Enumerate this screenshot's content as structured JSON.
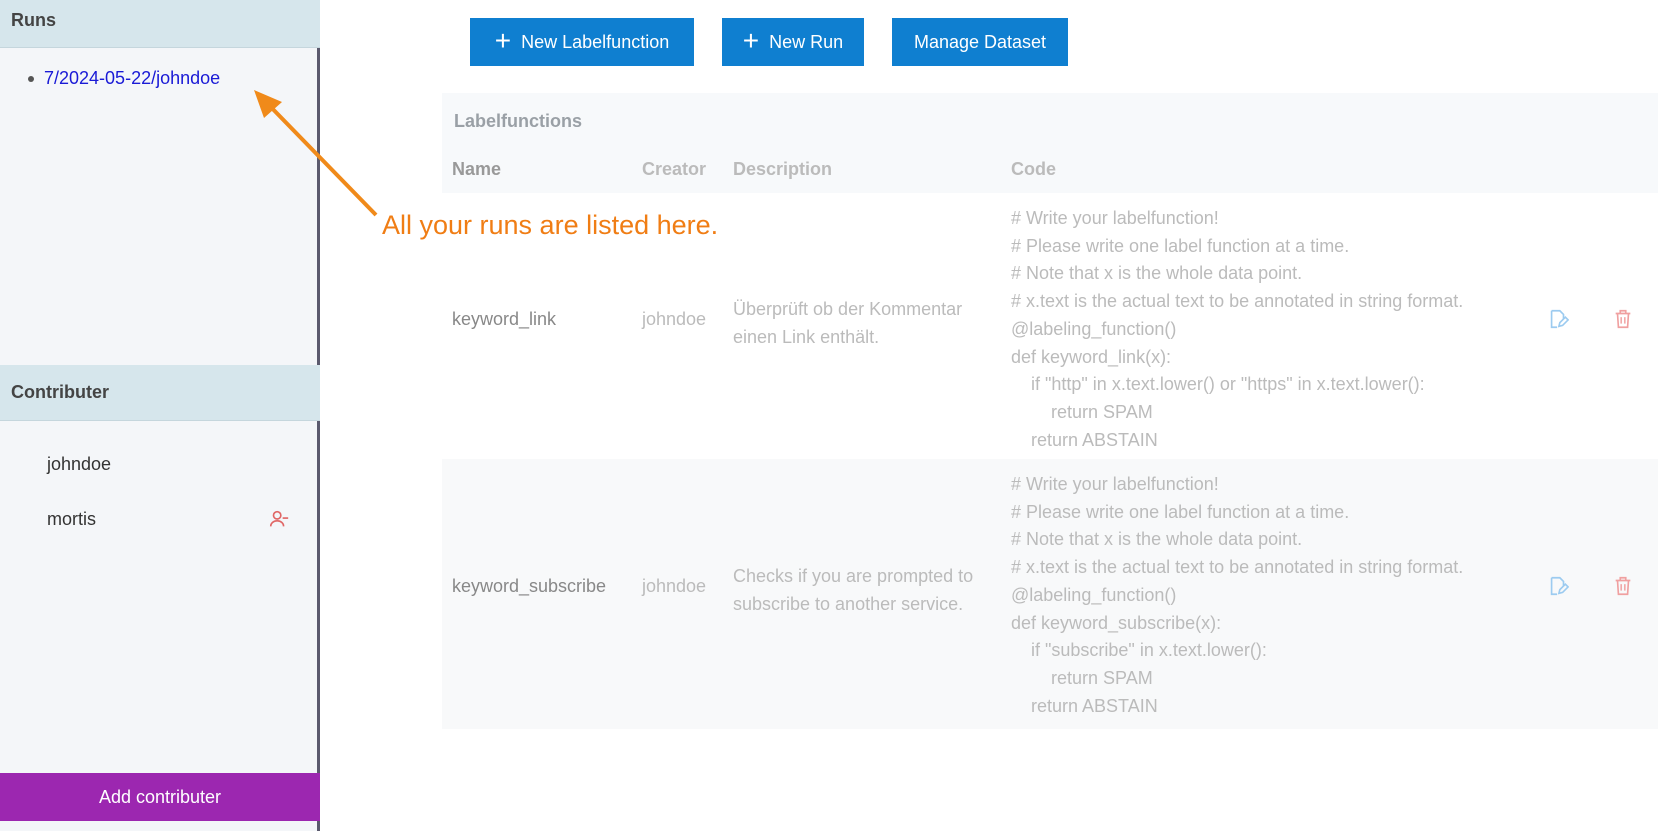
{
  "sidebar": {
    "runs_title": "Runs",
    "runs": [
      "7/2024-05-22/johndoe"
    ],
    "contributers_title": "Contributer",
    "contributers": [
      "johndoe",
      "mortis"
    ],
    "add_contributer_label": "Add contributer"
  },
  "toolbar": {
    "new_labelfunction_label": "New Labelfunction",
    "new_run_label": "New Run",
    "manage_dataset_label": "Manage Dataset"
  },
  "table": {
    "title": "Labelfunctions",
    "columns": {
      "name": "Name",
      "creator": "Creator",
      "description": "Description",
      "code": "Code"
    },
    "rows": [
      {
        "name": "keyword_link",
        "creator": "johndoe",
        "description": "Überprüft ob der Kommentar einen Link enthält.",
        "code": "# Write your labelfunction!\n# Please write one label function at a time.\n# Note that x is the whole data point.\n# x.text is the actual text to be annotated in string format.\n@labeling_function()\ndef keyword_link(x):\n    if \"http\" in x.text.lower() or \"https\" in x.text.lower():\n        return SPAM\n    return ABSTAIN"
      },
      {
        "name": "keyword_subscribe",
        "creator": "johndoe",
        "description": "Checks if you are prompted to subscribe to another service.",
        "code": "# Write your labelfunction!\n# Please write one label function at a time.\n# Note that x is the whole data point.\n# x.text is the actual text to be annotated in string format.\n@labeling_function()\ndef keyword_subscribe(x):\n    if \"subscribe\" in x.text.lower():\n        return SPAM\n    return ABSTAIN"
      }
    ]
  },
  "annotation": {
    "text": "All your runs are listed here."
  },
  "colors": {
    "accent_blue": "#0f7fd0",
    "add_contributer_purple": "#9c27b0",
    "annotation_orange": "#f07d14",
    "link_blue": "#1a1ad6",
    "remove_red": "#e06666"
  }
}
